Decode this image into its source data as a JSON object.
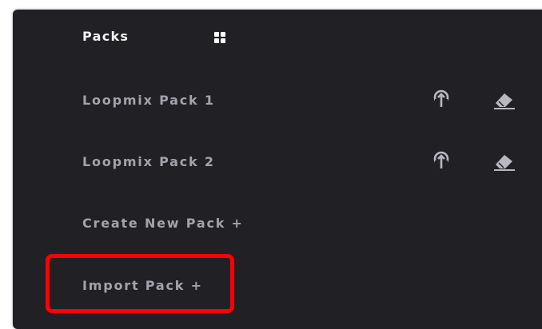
{
  "header": {
    "title": "Packs",
    "view_icon": "grid-view-icon"
  },
  "packs": [
    {
      "label": "Loopmix Pack 1",
      "actions": [
        "upload-icon",
        "eraser-icon"
      ]
    },
    {
      "label": "Loopmix Pack 2",
      "actions": [
        "upload-icon",
        "eraser-icon"
      ]
    }
  ],
  "actions": {
    "create_label": "Create New Pack +",
    "import_label": "Import Pack +"
  },
  "colors": {
    "panel_bg": "#212125",
    "header_text": "#f2f2f4",
    "item_text": "#a4a3ad",
    "highlight": "#ff0000"
  }
}
